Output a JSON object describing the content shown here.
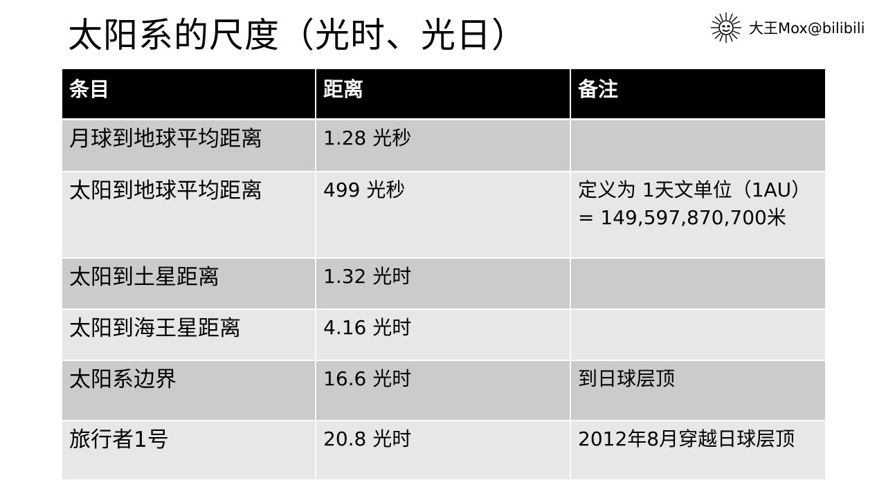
{
  "title": "太阳系的尺度（光时、光日）",
  "watermark": {
    "icon": "spiky-sun-logo",
    "text": "大王Mox@bilibili"
  },
  "table": {
    "headers": [
      "条目",
      "距离",
      "备注"
    ],
    "rows": [
      {
        "item": "月球到地球平均距离",
        "distance": "1.28 光秒",
        "note": "",
        "note2": ""
      },
      {
        "item": "太阳到地球平均距离",
        "distance": "499 光秒",
        "note": "定义为 1天文单位（1AU）",
        "note2": "= 149,597,870,700米"
      },
      {
        "item": "太阳到土星距离",
        "distance": "1.32 光时",
        "note": "",
        "note2": ""
      },
      {
        "item": "太阳到海王星距离",
        "distance": "4.16 光时",
        "note": "",
        "note2": ""
      },
      {
        "item": "太阳系边界",
        "distance": "16.6 光时",
        "note": "到日球层顶",
        "note2": ""
      },
      {
        "item": "旅行者1号",
        "distance": "20.8 光时",
        "note": "2012年8月穿越日球层顶",
        "note2": ""
      }
    ]
  },
  "colors": {
    "header_bg": "#000000",
    "row_dark": "#cbcbcb",
    "row_light": "#e7e7e7"
  }
}
